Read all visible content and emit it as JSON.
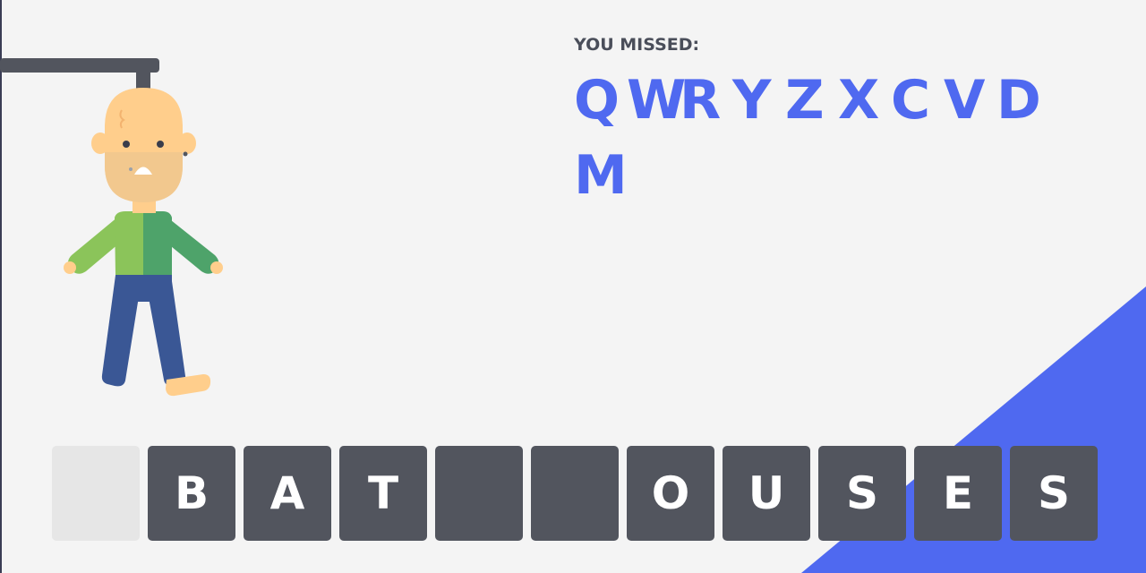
{
  "missed": {
    "label": "YOU MISSED:",
    "letters": [
      "Q",
      "W",
      "R",
      "Y",
      "Z",
      "X",
      "C",
      "V",
      "D",
      "M"
    ]
  },
  "word": {
    "tiles": [
      {
        "letter": "",
        "style": "empty-light"
      },
      {
        "letter": "B",
        "style": "dark"
      },
      {
        "letter": "A",
        "style": "dark"
      },
      {
        "letter": "T",
        "style": "dark"
      },
      {
        "letter": "",
        "style": "dark"
      },
      {
        "letter": "",
        "style": "dark"
      },
      {
        "letter": "O",
        "style": "dark"
      },
      {
        "letter": "U",
        "style": "dark"
      },
      {
        "letter": "S",
        "style": "dark"
      },
      {
        "letter": "E",
        "style": "dark"
      },
      {
        "letter": "S",
        "style": "dark"
      }
    ]
  },
  "colors": {
    "background": "#f4f4f4",
    "accent": "#4f69f0",
    "tile_dark": "#52555e",
    "tile_light": "#e6e6e6",
    "text_dark": "#4a4e5a"
  },
  "figure": {
    "icon": "hangman-figure"
  }
}
